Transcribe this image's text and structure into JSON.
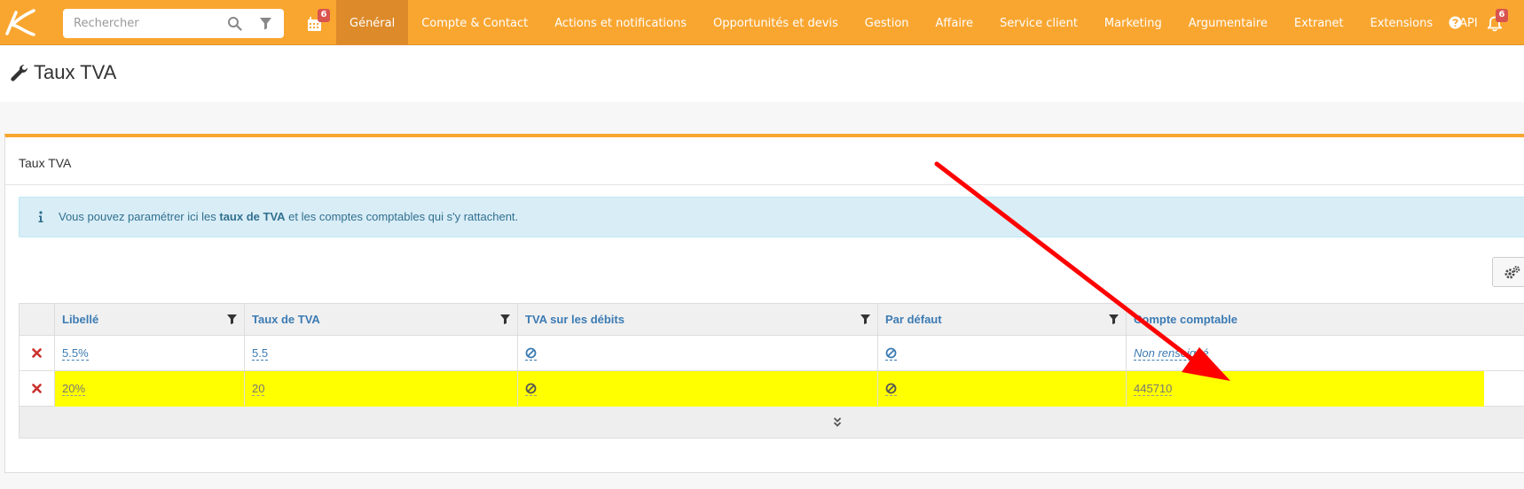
{
  "navbar": {
    "search_placeholder": "Rechercher",
    "calendar_badge": "6",
    "notifications_badge": "6",
    "menu": [
      "Général",
      "Compte & Contact",
      "Actions et notifications",
      "Opportunités et devis",
      "Gestion",
      "Affaire",
      "Service client",
      "Marketing",
      "Argumentaire",
      "Extranet",
      "Extensions",
      "API"
    ],
    "active_menu": "Général"
  },
  "page": {
    "title": "Taux TVA"
  },
  "panel": {
    "title": "Taux TVA",
    "alert": {
      "before": "Vous pouvez paramétrer ici les ",
      "bold": "taux de TVA",
      "after": " et les comptes comptables qui s'y rattachent."
    }
  },
  "table": {
    "columns": [
      "Libellé",
      "Taux de TVA",
      "TVA sur les débits",
      "Par défaut",
      "Compte comptable"
    ],
    "rows": [
      {
        "libelle": "5.5%",
        "taux": "5.5",
        "debits": "ban-icon",
        "defaut": "ban-icon",
        "compte": "Non renseigné"
      },
      {
        "libelle": "20%",
        "taux": "20",
        "debits": "ban-icon",
        "defaut": "ban-icon",
        "compte": "445710",
        "highlighted": true
      }
    ]
  },
  "colors": {
    "brand": "#f9a631",
    "active_menu": "#dd8a2a",
    "link": "#3c7bb3",
    "highlight": "#ffff00",
    "annotation_arrow": "#ff0000"
  }
}
